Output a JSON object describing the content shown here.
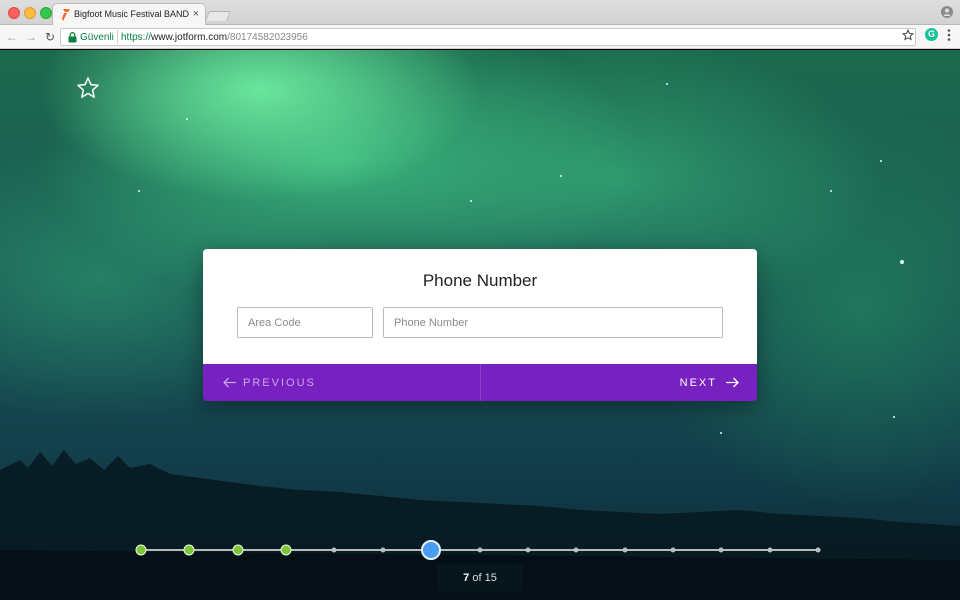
{
  "browser": {
    "tab_title": "Bigfoot Music Festival BAND A",
    "tab_close": "×",
    "secure_label": "Güvenli",
    "url_scheme": "https://",
    "url_host": "www.jotform.com",
    "url_path": "/80174582023956"
  },
  "form": {
    "question_title": "Phone Number",
    "area_code_placeholder": "Area Code",
    "phone_number_placeholder": "Phone Number",
    "previous_label": "PREVIOUS",
    "next_label": "NEXT",
    "accent_color": "#7721c1"
  },
  "progress": {
    "current": "7",
    "of_label": "of",
    "total": "15",
    "steps": [
      {
        "state": "done"
      },
      {
        "state": "done"
      },
      {
        "state": "done"
      },
      {
        "state": "done"
      },
      {
        "state": "todo"
      },
      {
        "state": "todo"
      },
      {
        "state": "current"
      },
      {
        "state": "todo"
      },
      {
        "state": "todo"
      },
      {
        "state": "todo"
      },
      {
        "state": "todo"
      },
      {
        "state": "todo"
      },
      {
        "state": "todo"
      },
      {
        "state": "todo"
      },
      {
        "state": "todo"
      }
    ]
  },
  "icons": {
    "favorite": "star-outline-icon",
    "previous": "arrow-left-icon",
    "next": "arrow-right-icon"
  }
}
